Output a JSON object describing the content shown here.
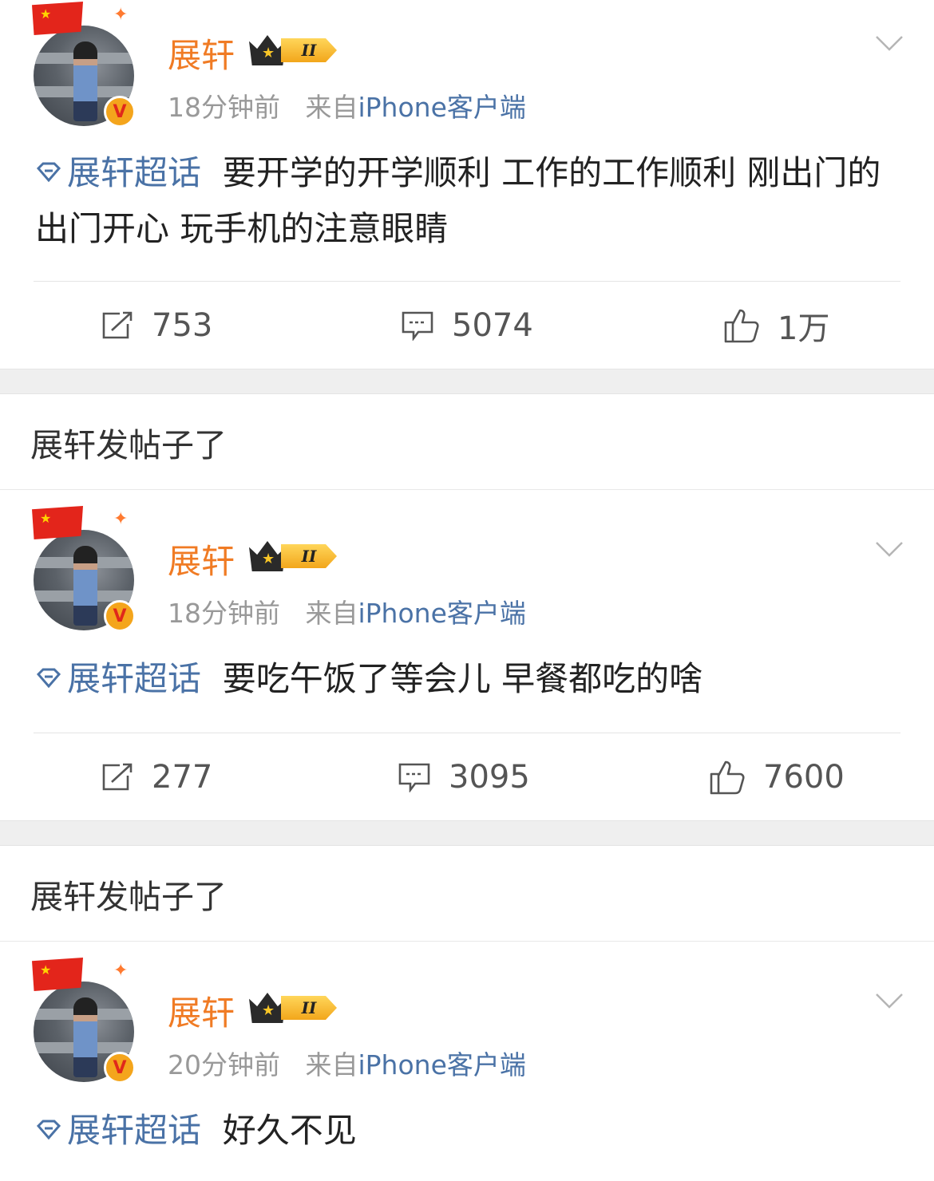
{
  "posts": [
    {
      "name": "展轩",
      "level": "II",
      "time": "18分钟前",
      "from": "来自",
      "source": "iPhone客户端",
      "topic": "展轩超话",
      "text": "要开学的开学顺利 工作的工作顺利 刚出门的出门开心 玩手机的注意眼睛",
      "reposts": "753",
      "comments": "5074",
      "likes": "1万"
    },
    {
      "name": "展轩",
      "level": "II",
      "time": "18分钟前",
      "from": "来自",
      "source": "iPhone客户端",
      "topic": "展轩超话",
      "text": "要吃午饭了等会儿 早餐都吃的啥",
      "reposts": "277",
      "comments": "3095",
      "likes": "7600"
    },
    {
      "name": "展轩",
      "level": "II",
      "time": "20分钟前",
      "from": "来自",
      "source": "iPhone客户端",
      "topic": "展轩超话",
      "text": "好久不见"
    }
  ],
  "section_titles": [
    "展轩发帖子了",
    "展轩发帖子了"
  ],
  "icons": {
    "verified": "V",
    "crown": "crown-icon",
    "flag": "china-flag-icon"
  },
  "colors": {
    "name": "#f07b24",
    "link": "#4a72a6",
    "meta": "#999999",
    "divider": "#efefef"
  }
}
